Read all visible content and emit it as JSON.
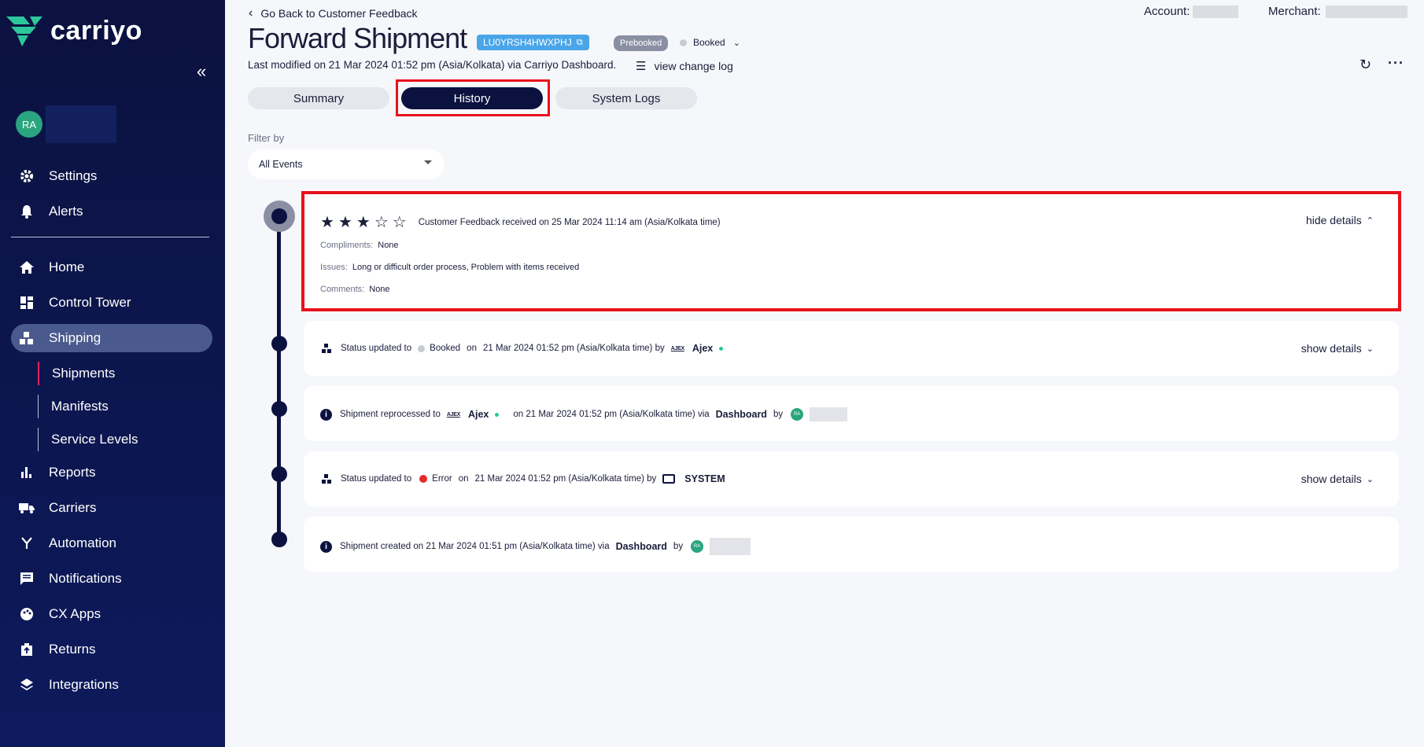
{
  "brand": {
    "name": "carriyo"
  },
  "sidebar": {
    "user_initials": "RA",
    "items": [
      {
        "label": "Settings",
        "icon": "gear-icon"
      },
      {
        "label": "Alerts",
        "icon": "bell-icon"
      },
      {
        "label": "Home",
        "icon": "home-icon"
      },
      {
        "label": "Control Tower",
        "icon": "dashboard-icon"
      },
      {
        "label": "Shipping",
        "icon": "boxes-icon"
      },
      {
        "label": "Reports",
        "icon": "bar-chart-icon"
      },
      {
        "label": "Carriers",
        "icon": "truck-icon"
      },
      {
        "label": "Automation",
        "icon": "merge-icon"
      },
      {
        "label": "Notifications",
        "icon": "chat-icon"
      },
      {
        "label": "CX Apps",
        "icon": "palette-icon"
      },
      {
        "label": "Returns",
        "icon": "return-box-icon"
      },
      {
        "label": "Integrations",
        "icon": "layers-icon"
      }
    ],
    "sub_items": [
      "Shipments",
      "Manifests",
      "Service Levels"
    ]
  },
  "header": {
    "back_label": "Go Back to Customer Feedback",
    "account_label": "Account:",
    "merchant_label": "Merchant:",
    "title": "Forward Shipment",
    "awb": "LU0YRSH4HWXPHJ",
    "badge": "Prebooked",
    "status": "Booked",
    "modified": "Last modified on 21 Mar 2024 01:52 pm (Asia/Kolkata) via Carriyo Dashboard.",
    "change_log": "view change log"
  },
  "tabs": [
    "Summary",
    "History",
    "System Logs"
  ],
  "filter": {
    "label": "Filter by",
    "value": "All Events"
  },
  "events": {
    "feedback": {
      "rating": 3,
      "max_rating": 5,
      "text": "Customer Feedback received on 25 Mar 2024 11:14 am (Asia/Kolkata time)",
      "toggle": "hide details",
      "compliments_key": "Compliments:",
      "compliments": "None",
      "issues_key": "Issues:",
      "issues": "Long or difficult order process, Problem with items received",
      "comments_key": "Comments:",
      "comments": "None"
    },
    "status1": {
      "prefix": "Status updated to",
      "status": "Booked",
      "on": "on",
      "date": "21 Mar 2024 01:52 pm (Asia/Kolkata time) by",
      "carrier_logo": "AJEX",
      "carrier": "Ajex",
      "toggle": "show details"
    },
    "reprocessed": {
      "prefix": "Shipment reprocessed to",
      "carrier_logo": "AJEX",
      "carrier": "Ajex",
      "date": "on 21 Mar 2024 01:52 pm (Asia/Kolkata time) via",
      "via": "Dashboard",
      "by": "by",
      "avatar": "RA"
    },
    "status2": {
      "prefix": "Status updated to",
      "status": "Error",
      "on": "on",
      "date": "21 Mar 2024 01:52 pm (Asia/Kolkata time) by",
      "actor": "SYSTEM",
      "toggle": "show details"
    },
    "created": {
      "prefix": "Shipment created on 21 Mar 2024 01:51 pm (Asia/Kolkata time) via",
      "via": "Dashboard",
      "by": "by",
      "avatar": "RA"
    }
  }
}
